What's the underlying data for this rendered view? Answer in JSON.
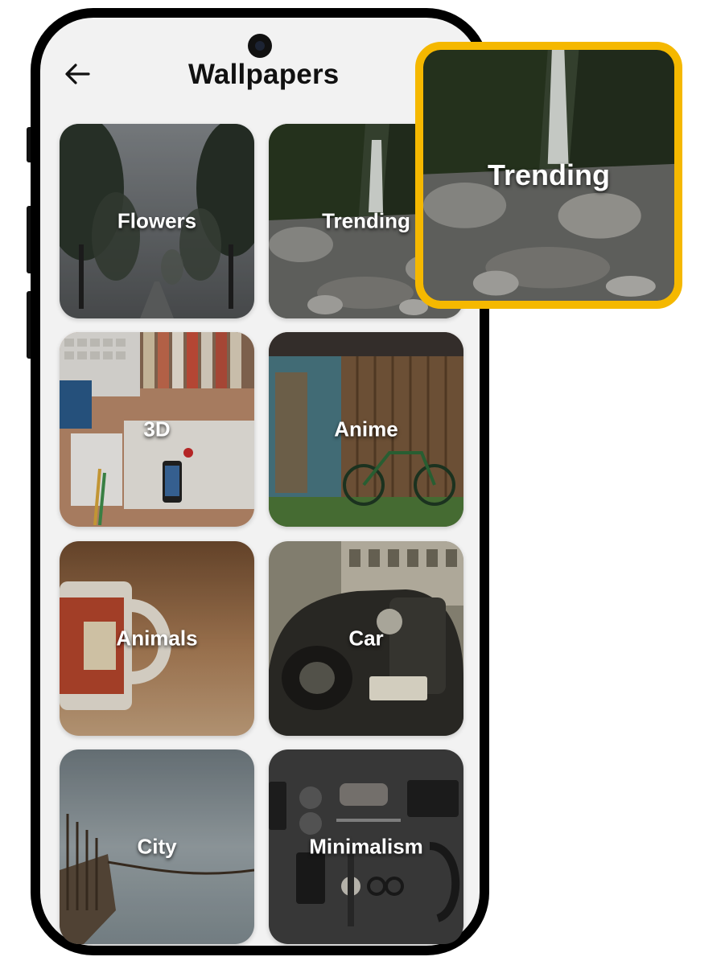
{
  "header": {
    "back_icon": "arrow-left-icon",
    "title": "Wallpapers"
  },
  "categories": [
    {
      "label": "Flowers"
    },
    {
      "label": "Trending"
    },
    {
      "label": "3D"
    },
    {
      "label": "Anime"
    },
    {
      "label": "Animals"
    },
    {
      "label": "Car"
    },
    {
      "label": "City"
    },
    {
      "label": "Minimalism"
    }
  ],
  "callout": {
    "label": "Trending",
    "border_color": "#f5b800"
  }
}
